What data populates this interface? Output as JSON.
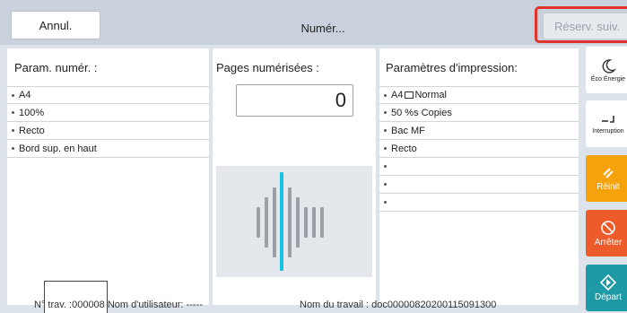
{
  "header": {
    "cancel_label": "Annul.",
    "title": "Numér...",
    "reserve_label": "Réserv. suiv."
  },
  "scan_params": {
    "title": "Param. numér. :",
    "items": [
      "A4",
      "100%",
      "Recto",
      "Bord sup. en haut"
    ]
  },
  "scanned_pages": {
    "title": "Pages numérisées :",
    "count": "0"
  },
  "print_params": {
    "title": "Paramètres d'impression:",
    "items": [
      {
        "prefix": "A4",
        "suffix": "Normal",
        "icon": "page-icon"
      },
      {
        "prefix": "50  %s Copies",
        "suffix": "",
        "icon": ""
      },
      {
        "prefix": "Bac MF",
        "suffix": "",
        "icon": ""
      },
      {
        "prefix": "Recto",
        "suffix": "",
        "icon": ""
      },
      {
        "prefix": "",
        "suffix": "",
        "icon": ""
      },
      {
        "prefix": "",
        "suffix": "",
        "icon": ""
      },
      {
        "prefix": "",
        "suffix": "",
        "icon": ""
      }
    ]
  },
  "footer": {
    "job_number": "N° trav. :000008 Nom d'utilisateur: -----",
    "job_name": "Nom du travail : doc00000820200115091300"
  },
  "side_buttons": {
    "eco": {
      "label": "Éco Énergie",
      "icon": "moon-icon"
    },
    "interrupt": {
      "label": "Interruption",
      "icon": "interrupt-icon"
    },
    "reset": {
      "label": "Réinit",
      "icon": "reset-icon"
    },
    "stop": {
      "label": "Arrêter",
      "icon": "stop-icon"
    },
    "start": {
      "label": "Départ",
      "icon": "start-icon"
    }
  },
  "colors": {
    "reserve_highlight": "#e0332c",
    "reset": "#f5a20c",
    "stop": "#ee5b2a",
    "start": "#1e9aa6",
    "scan_active": "#14c3e6"
  }
}
